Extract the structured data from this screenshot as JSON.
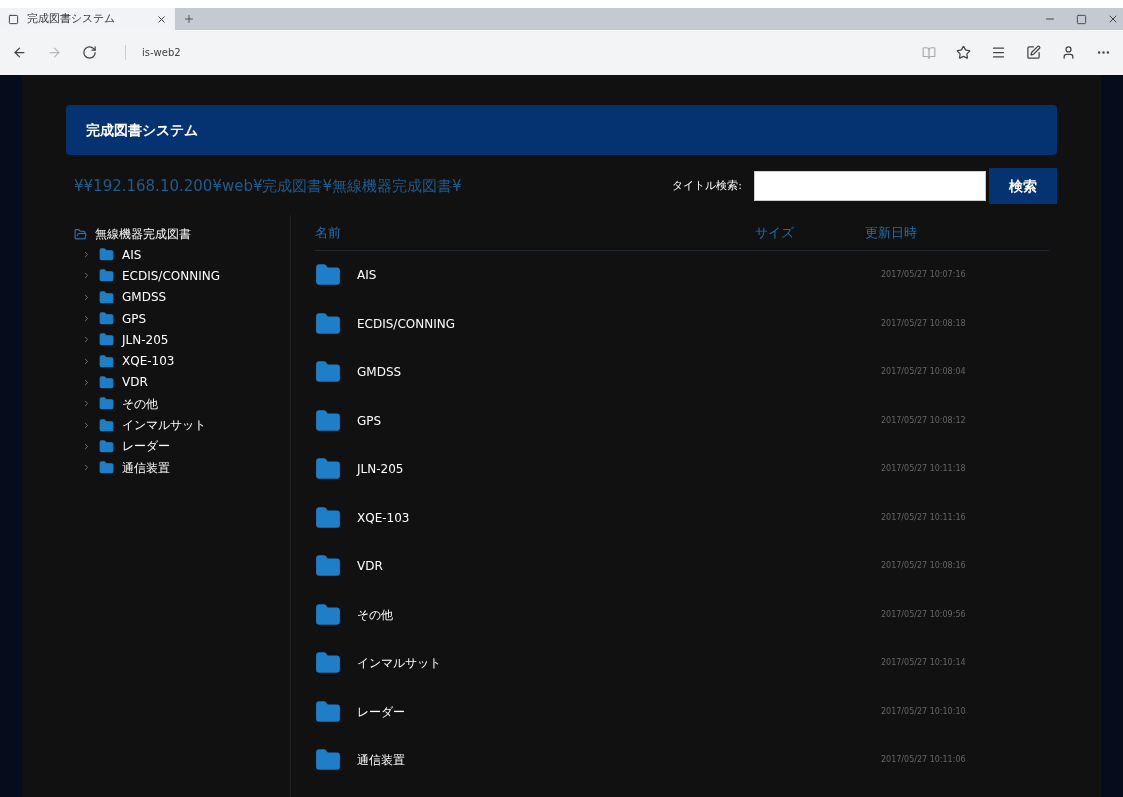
{
  "browser": {
    "tab_title": "完成図書システム",
    "address": "is-web2"
  },
  "header": {
    "title": "完成図書システム"
  },
  "path": "¥¥192.168.10.200¥web¥完成図書¥無線機器完成図書¥",
  "search": {
    "label": "タイトル検索:",
    "button": "検索"
  },
  "tree": {
    "root": "無線機器完成図書",
    "children": [
      {
        "label": "AIS",
        "expanded": false
      },
      {
        "label": "ECDIS/CONNING",
        "expanded": false
      },
      {
        "label": "GMDSS",
        "expanded": false
      },
      {
        "label": "GPS",
        "expanded": false
      },
      {
        "label": "JLN-205",
        "expanded": false
      },
      {
        "label": "XQE-103",
        "expanded": false
      },
      {
        "label": "VDR",
        "expanded": false
      },
      {
        "label": "その他",
        "expanded": false
      },
      {
        "label": "インマルサット",
        "expanded": false
      },
      {
        "label": "レーダー",
        "expanded": false
      },
      {
        "label": "通信装置",
        "expanded": false
      }
    ]
  },
  "table": {
    "columns": [
      "名前",
      "サイズ",
      "更新日時"
    ],
    "rows": [
      {
        "name": "AIS",
        "modified": "2017/05/27 10:07:16"
      },
      {
        "name": "ECDIS/CONNING",
        "modified": "2017/05/27 10:08:18"
      },
      {
        "name": "GMDSS",
        "modified": "2017/05/27 10:08:04"
      },
      {
        "name": "GPS",
        "modified": "2017/05/27 10:08:12"
      },
      {
        "name": "JLN-205",
        "modified": "2017/05/27 10:11:18"
      },
      {
        "name": "XQE-103",
        "modified": "2017/05/27 10:11:16"
      },
      {
        "name": "VDR",
        "modified": "2017/05/27 10:08:16"
      },
      {
        "name": "その他",
        "modified": "2017/05/27 10:09:56"
      },
      {
        "name": "インマルサット",
        "modified": "2017/05/27 10:10:14"
      },
      {
        "name": "レーダー",
        "modified": "2017/05/27 10:10:10"
      },
      {
        "name": "通信装置",
        "modified": "2017/05/27 10:11:06"
      }
    ]
  }
}
